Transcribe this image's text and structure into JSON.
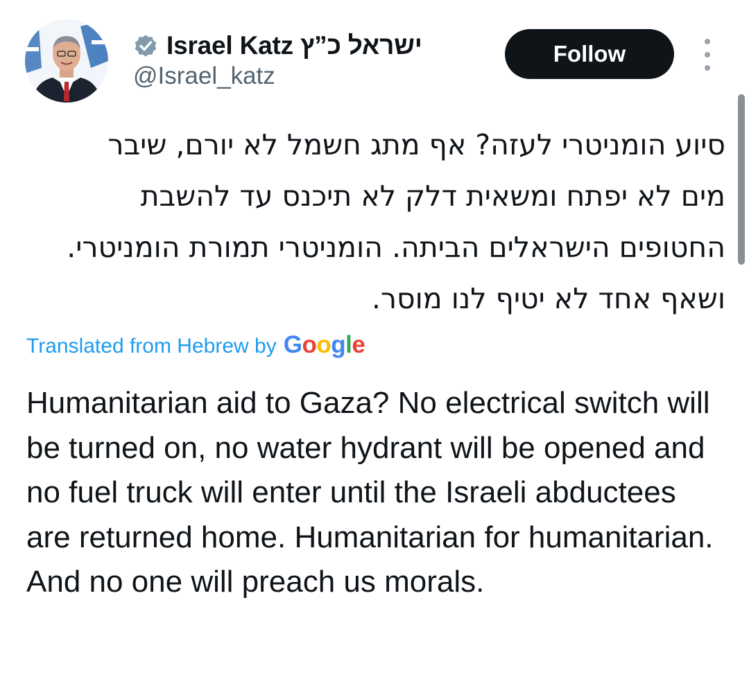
{
  "tweet": {
    "author": {
      "display_name": "Israel Katz ישראל כ”ץ",
      "handle": "@Israel_katz",
      "avatar_icon": "profile-photo",
      "verified_icon": "verified-badge-icon",
      "verified_color": "#829aab"
    },
    "follow_label": "Follow",
    "more_icon": "more-vertical-icon",
    "original_text": "סיוע הומניטרי לעזה? אף מתג חשמל לא יורם, שיבר מים לא יפתח ומשאית דלק לא תיכנס עד להשבת החטופים הישראלים הביתה. הומניטרי תמורת הומניטרי. ושאף אחד לא יטיף לנו מוסר.",
    "translation": {
      "label": "Translated from Hebrew by",
      "provider": "Google",
      "text": "Humanitarian aid to Gaza? No electrical switch will be turned on, no water hydrant will be opened and no fuel truck will enter until the Israeli abductees are returned home. Humanitarian for humanitarian. And no one will preach us morals."
    }
  },
  "colors": {
    "text_primary": "#0f1419",
    "text_secondary": "#536471",
    "link_blue": "#1d9bf0",
    "follow_button_bg": "#0f1419",
    "follow_button_text": "#ffffff",
    "google_blue": "#4285f4",
    "google_red": "#ea4335",
    "google_yellow": "#fbbc05",
    "google_green": "#34a853"
  }
}
